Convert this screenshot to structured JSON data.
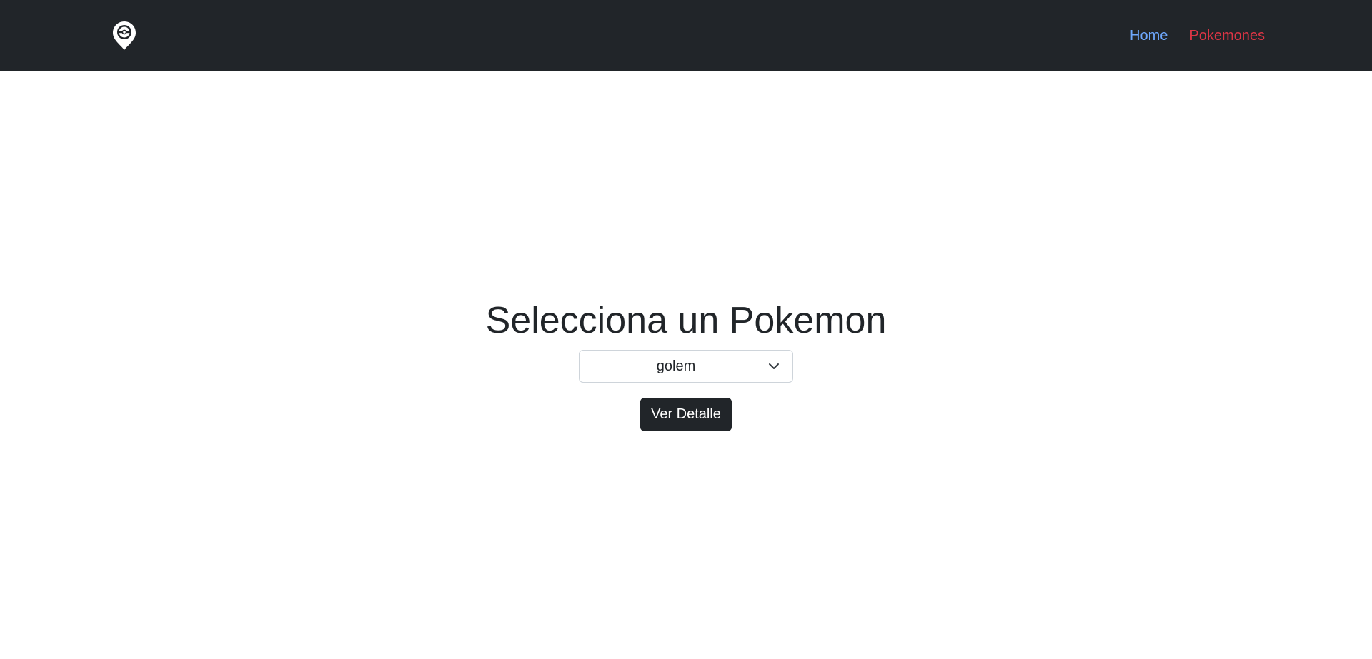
{
  "navbar": {
    "logo_icon": "pokeball-location-pin-icon",
    "links": [
      {
        "label": "Home",
        "color": "#6ea8fe"
      },
      {
        "label": "Pokemones",
        "color": "#dc3545"
      }
    ],
    "background": "#212529"
  },
  "main": {
    "title": "Selecciona un Pokemon",
    "select": {
      "selected_value": "golem",
      "icon": "chevron-down-icon"
    },
    "detail_button": {
      "label": "Ver Detalle",
      "background": "#212529"
    }
  }
}
